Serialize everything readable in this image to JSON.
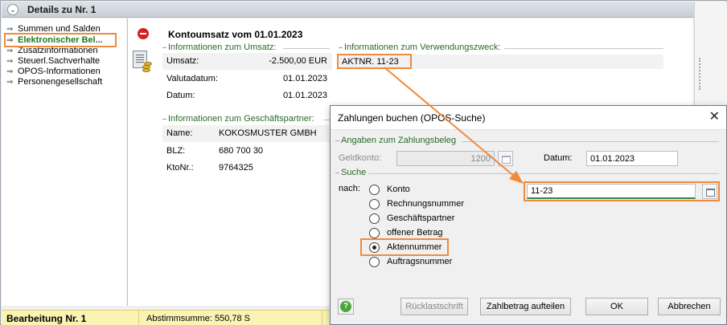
{
  "header": {
    "title": "Details zu Nr. 1"
  },
  "nav": {
    "items": [
      {
        "label": "Summen und Salden",
        "active": false
      },
      {
        "label": "Elektronischer Bel...",
        "active": true
      },
      {
        "label": "Zusatzinformationen",
        "active": false
      },
      {
        "label": "Steuerl.Sachverhalte",
        "active": false
      },
      {
        "label": "OPOS-Informationen",
        "active": false
      },
      {
        "label": "Personengesellschaft",
        "active": false
      }
    ]
  },
  "detail": {
    "title": "Kontoumsatz vom 01.01.2023",
    "umsatz_group": "Informationen zum Umsatz:",
    "umsatz_rows": [
      {
        "label": "Umsatz:",
        "value": "-2.500,00 EUR"
      },
      {
        "label": "Valutadatum:",
        "value": "01.01.2023"
      },
      {
        "label": "Datum:",
        "value": "01.01.2023"
      }
    ],
    "vzweck_group": "Informationen zum Verwendungszweck:",
    "vzweck_value": "AKTNR. 11-23",
    "partner_group": "Informationen zum Geschäftspartner:",
    "partner_rows": [
      {
        "label": "Name:",
        "value": "KOKOSMUSTER GMBH"
      },
      {
        "label": "BLZ:",
        "value": "680 700 30"
      },
      {
        "label": "KtoNr.:",
        "value": "9764325"
      }
    ]
  },
  "status": {
    "left": "Bearbeitung Nr. 1",
    "sum": "Abstimmsumme: 550,78 S"
  },
  "dialog": {
    "title": "Zahlungen buchen (OPOS-Suche)",
    "close": "✕",
    "beleg_group": "Angaben zum Zahlungsbeleg",
    "geldkonto_label": "Geldkonto:",
    "geldkonto_value": "1200",
    "datum_label": "Datum:",
    "datum_value": "01.01.2023",
    "suche_group": "Suche",
    "nach_label": "nach:",
    "search_value": "11-23",
    "options": [
      {
        "label": "Konto",
        "selected": false
      },
      {
        "label": "Rechnungsnummer",
        "selected": false
      },
      {
        "label": "Geschäftspartner",
        "selected": false
      },
      {
        "label": "offener Betrag",
        "selected": false
      },
      {
        "label": "Aktennummer",
        "selected": true
      },
      {
        "label": "Auftragsnummer",
        "selected": false
      }
    ],
    "buttons": {
      "ruecklast": "Rücklastschrift",
      "aufteilen": "Zahlbetrag aufteilen",
      "ok": "OK",
      "abbrechen": "Abbrechen"
    },
    "help": "?"
  },
  "colors": {
    "highlight": "#f08a3c",
    "active_nav": "#1f7a1f",
    "group_label": "#2a6a2a",
    "status_bg": "#faf3b4"
  }
}
